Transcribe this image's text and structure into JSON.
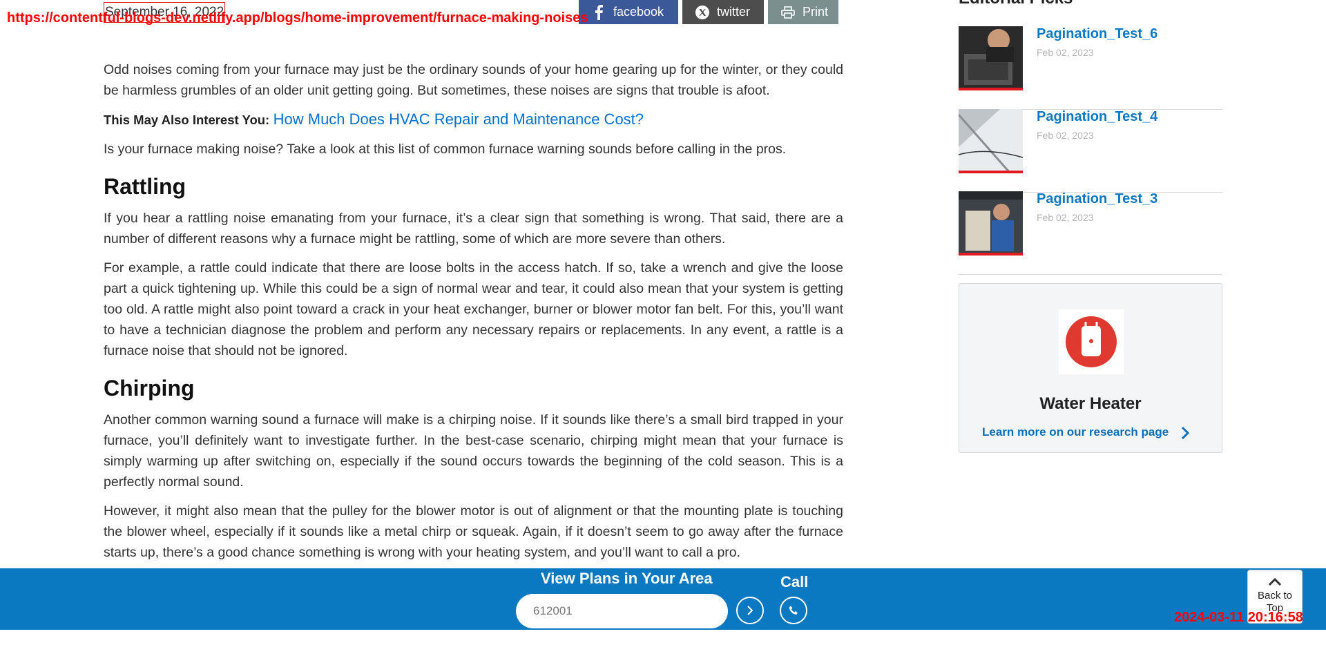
{
  "header": {
    "date": "September 16, 2022",
    "url_overlay": "https://contentful-blogs-dev.netlify.app/blogs/home-improvement/furnace-making-noises",
    "share": {
      "facebook_label": "facebook",
      "twitter_label": "twitter",
      "print_label": "Print"
    }
  },
  "article": {
    "intro": "Odd noises coming from your furnace may just be the ordinary sounds of your home gearing up for the winter, or they could be harmless grumbles of an older unit getting going. But sometimes, these noises are signs that trouble is afoot.",
    "interest_label": "This May Also Interest You:",
    "interest_link": "How Much Does HVAC Repair and Maintenance Cost?",
    "lead": "Is your furnace making noise? Take a look at this list of common furnace warning sounds before calling in the pros.",
    "sections": [
      {
        "heading": "Rattling",
        "paragraphs": [
          "If you hear a rattling noise emanating from your furnace, it’s a clear sign that something is wrong. That said, there are a number of different reasons why a furnace might be rattling, some of which are more severe than others.",
          "For example, a rattle could indicate that there are loose bolts in the access hatch. If so, take a wrench and give the loose part a quick tightening up. While this could be a sign of normal wear and tear, it could also mean that your system is getting too old. A rattle might also point toward a crack in your heat exchanger, burner or blower motor fan belt. For this, you’ll want to have a technician diagnose the problem and perform any necessary repairs or replacements. In any event, a rattle is a furnace noise that should not be ignored."
        ]
      },
      {
        "heading": "Chirping",
        "paragraphs": [
          "Another common warning sound a furnace will make is a chirping noise. If it sounds like there’s a small bird trapped in your furnace, you’ll definitely want to investigate further. In the best-case scenario, chirping might mean that your furnace is simply warming up after switching on, especially if the sound occurs towards the beginning of the cold season. This is a perfectly normal sound.",
          "However, it might also mean that the pulley for the blower motor is out of alignment or that the mounting plate is touching the blower wheel, especially if it sounds like a metal chirp or squeak. Again, if it doesn’t seem to go away after the furnace starts up, there’s a good chance something is wrong with your heating system, and you’ll want to call a pro."
        ]
      }
    ]
  },
  "sidebar": {
    "heading": "Editorial Picks",
    "picks": [
      {
        "title": "Pagination_Test_6",
        "date": "Feb 02, 2023",
        "icon": "photo-technician-icon"
      },
      {
        "title": "Pagination_Test_4",
        "date": "Feb 02, 2023",
        "icon": "photo-roof-gutter-icon"
      },
      {
        "title": "Pagination_Test_3",
        "date": "Feb 02, 2023",
        "icon": "photo-water-heater-icon"
      }
    ],
    "research_card": {
      "title": "Water Heater",
      "link_label": "Learn more on our research page",
      "icon": "water-heater-icon"
    }
  },
  "bottom_bar": {
    "title": "View Plans in Your Area",
    "zip_value": "612001",
    "call_label": "Call",
    "back_to_top": "Back to Top"
  },
  "overlay": {
    "timestamp": "2024-03-11 20:16:58"
  },
  "colors": {
    "brand_blue": "#0b78c2",
    "link_blue": "#0071d0",
    "accent_red": "#e21b23",
    "facebook": "#3b5998",
    "twitter": "#4d4d4d",
    "print": "#7b8f8f"
  }
}
